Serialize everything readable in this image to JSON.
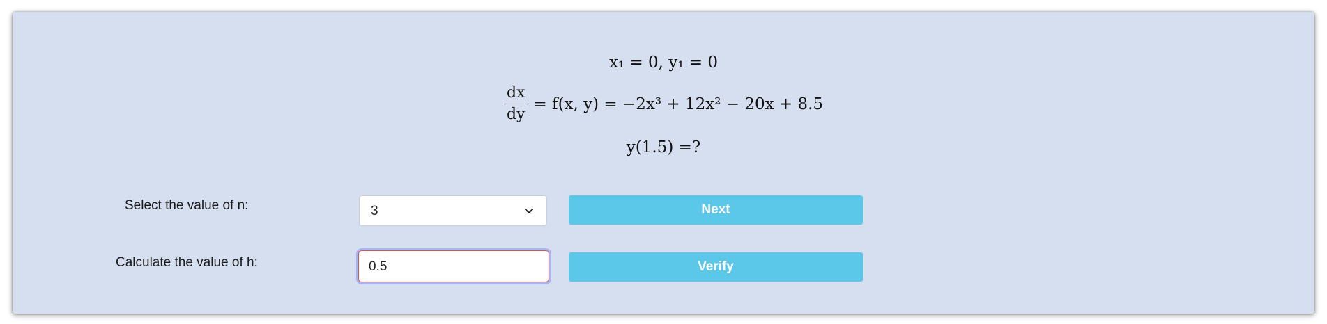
{
  "problem": {
    "initial_conditions": "x₁ = 0, y₁ = 0",
    "equation_numerator": "dx",
    "equation_denominator": "dy",
    "equation_rhs": "= f(x, y) = −2x³ + 12x² − 20x + 8.5",
    "query": "y(1.5) =?"
  },
  "form": {
    "n_label": "Select the value of n:",
    "n_selected": "3",
    "next_label": "Next",
    "h_label": "Calculate the value of h:",
    "h_value": "0.5",
    "verify_label": "Verify"
  },
  "colors": {
    "panel_bg": "#d6dff0",
    "button_bg": "#5bc8ea",
    "input_error_border": "#d9534f",
    "input_focus_ring": "#aab5f0"
  },
  "icons": {
    "select_chevron": "chevron-down-icon"
  }
}
